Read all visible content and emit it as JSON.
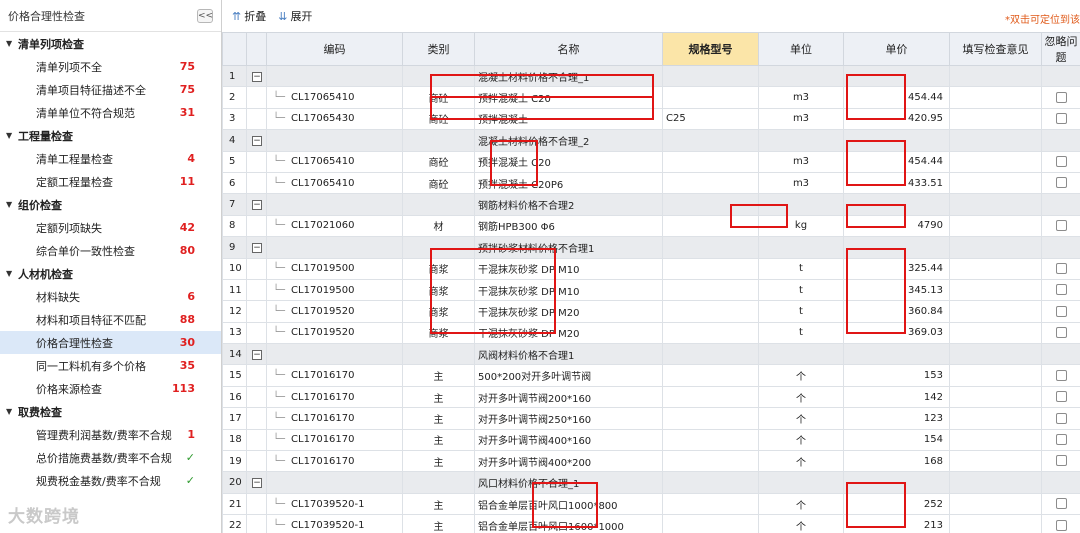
{
  "left": {
    "title": "价格合理性检查",
    "collapse_label": "<<",
    "groups": [
      {
        "label": "清单列项检查",
        "items": [
          {
            "label": "清单列项不全",
            "count": "75",
            "type": "count"
          },
          {
            "label": "清单项目特征描述不全",
            "count": "75",
            "type": "count"
          },
          {
            "label": "清单单位不符合规范",
            "count": "31",
            "type": "count"
          }
        ]
      },
      {
        "label": "工程量检查",
        "items": [
          {
            "label": "清单工程量检查",
            "count": "4",
            "type": "count"
          },
          {
            "label": "定额工程量检查",
            "count": "11",
            "type": "count"
          }
        ]
      },
      {
        "label": "组价检查",
        "items": [
          {
            "label": "定额列项缺失",
            "count": "42",
            "type": "count"
          },
          {
            "label": "综合单价一致性检查",
            "count": "80",
            "type": "count"
          }
        ]
      },
      {
        "label": "人材机检查",
        "items": [
          {
            "label": "材料缺失",
            "count": "6",
            "type": "count"
          },
          {
            "label": "材料和项目特征不匹配",
            "count": "88",
            "type": "count"
          },
          {
            "label": "价格合理性检查",
            "count": "30",
            "type": "count",
            "selected": true
          },
          {
            "label": "同一工料机有多个价格",
            "count": "35",
            "type": "count"
          },
          {
            "label": "价格来源检查",
            "count": "113",
            "type": "count"
          }
        ]
      },
      {
        "label": "取费检查",
        "items": [
          {
            "label": "管理费利润基数/费率不合规",
            "count": "1",
            "type": "count"
          },
          {
            "label": "总价措施费基数/费率不合规",
            "count": "✓",
            "type": "ok"
          },
          {
            "label": "规费税金基数/费率不合规",
            "count": "✓",
            "type": "ok"
          }
        ]
      }
    ],
    "watermark": "大数跨境"
  },
  "toolbar": {
    "collapse_label": "折叠",
    "expand_label": "展开",
    "hint": "*双击可定位到该"
  },
  "table": {
    "headers": [
      "",
      "",
      "编码",
      "类别",
      "名称",
      "规格型号",
      "单位",
      "单价",
      "填写检查意见",
      "忽略问题"
    ],
    "rows": [
      {
        "no": "1",
        "group": true,
        "name": "混凝土材料价格不合理_1"
      },
      {
        "no": "2",
        "code": "CL17065410",
        "cat": "商砼",
        "name": "预拌混凝土 C20",
        "spec": "",
        "unit": "m3",
        "price": "454.44"
      },
      {
        "no": "3",
        "code": "CL17065430",
        "cat": "商砼",
        "name": "预拌混凝土",
        "spec": "C25",
        "unit": "m3",
        "price": "420.95"
      },
      {
        "no": "4",
        "group": true,
        "name": "混凝土材料价格不合理_2"
      },
      {
        "no": "5",
        "code": "CL17065410",
        "cat": "商砼",
        "name": "预拌混凝土 C20",
        "spec": "",
        "unit": "m3",
        "price": "454.44"
      },
      {
        "no": "6",
        "code": "CL17065410",
        "cat": "商砼",
        "name": "预拌混凝土 C20P6",
        "spec": "",
        "unit": "m3",
        "price": "433.51"
      },
      {
        "no": "7",
        "group": true,
        "name": "钢筋材料价格不合理2"
      },
      {
        "no": "8",
        "code": "CL17021060",
        "cat": "材",
        "name": "钢筋HPB300 Φ6",
        "spec": "",
        "unit": "kg",
        "price": "4790"
      },
      {
        "no": "9",
        "group": true,
        "name": "预拌砂浆材料价格不合理1"
      },
      {
        "no": "10",
        "code": "CL17019500",
        "cat": "商浆",
        "name": "干混抹灰砂浆 DP M10",
        "spec": "",
        "unit": "t",
        "price": "325.44"
      },
      {
        "no": "11",
        "code": "CL17019500",
        "cat": "商浆",
        "name": "干混抹灰砂浆 DP M10",
        "spec": "",
        "unit": "t",
        "price": "345.13"
      },
      {
        "no": "12",
        "code": "CL17019520",
        "cat": "商浆",
        "name": "干混抹灰砂浆 DP M20",
        "spec": "",
        "unit": "t",
        "price": "360.84"
      },
      {
        "no": "13",
        "code": "CL17019520",
        "cat": "商浆",
        "name": "干混抹灰砂浆 DP M20",
        "spec": "",
        "unit": "t",
        "price": "369.03"
      },
      {
        "no": "14",
        "group": true,
        "name": "风阀材料价格不合理1"
      },
      {
        "no": "15",
        "code": "CL17016170",
        "cat": "主",
        "name": "500*200对开多叶调节阀",
        "spec": "",
        "unit": "个",
        "price": "153"
      },
      {
        "no": "16",
        "code": "CL17016170",
        "cat": "主",
        "name": "对开多叶调节阀200*160",
        "spec": "",
        "unit": "个",
        "price": "142"
      },
      {
        "no": "17",
        "code": "CL17016170",
        "cat": "主",
        "name": "对开多叶调节阀250*160",
        "spec": "",
        "unit": "个",
        "price": "123"
      },
      {
        "no": "18",
        "code": "CL17016170",
        "cat": "主",
        "name": "对开多叶调节阀400*160",
        "spec": "",
        "unit": "个",
        "price": "154"
      },
      {
        "no": "19",
        "code": "CL17016170",
        "cat": "主",
        "name": "对开多叶调节阀400*200",
        "spec": "",
        "unit": "个",
        "price": "168"
      },
      {
        "no": "20",
        "group": true,
        "name": "风口材料价格不合理_1"
      },
      {
        "no": "21",
        "code": "CL17039520-1",
        "cat": "主",
        "name": "铝合金单层百叶风口1000*800",
        "spec": "",
        "unit": "个",
        "price": "252"
      },
      {
        "no": "22",
        "code": "CL17039520-1",
        "cat": "主",
        "name": "铝合金单层百叶风口1600*1000",
        "spec": "",
        "unit": "个",
        "price": "213"
      }
    ]
  },
  "colors": {
    "highlight": "#e01515",
    "count": "#e02020",
    "ok": "#2e9a2e",
    "selected": "#dbe8f8",
    "spec_header": "#fbe5a8"
  },
  "icons": [
    "collapse-panel-icon",
    "fold-icon",
    "expand-icon",
    "tree-collapse-icon",
    "checkbox-icon"
  ]
}
